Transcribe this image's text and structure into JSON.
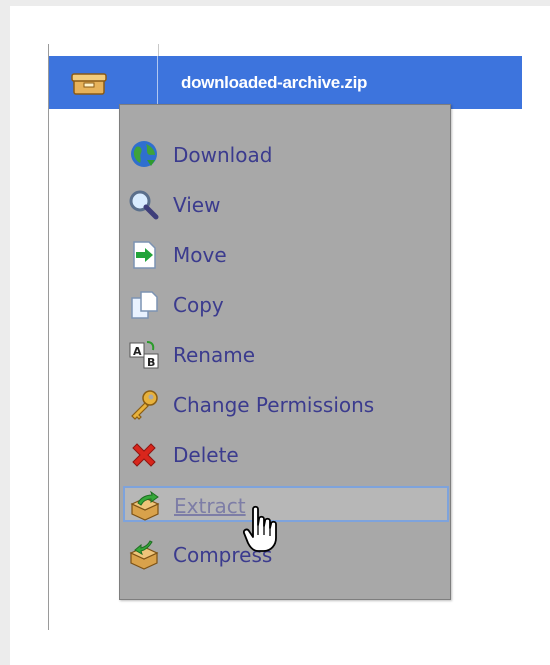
{
  "file_row": {
    "filename": "downloaded-archive.zip",
    "icon": "archive-box-icon"
  },
  "context_menu": {
    "items": [
      {
        "label": "Download",
        "icon": "globe-download-icon"
      },
      {
        "label": "View",
        "icon": "magnifier-icon"
      },
      {
        "label": "Move",
        "icon": "move-arrow-icon"
      },
      {
        "label": "Copy",
        "icon": "copy-pages-icon"
      },
      {
        "label": "Rename",
        "icon": "rename-ab-icon"
      },
      {
        "label": "Change Permissions",
        "icon": "key-icon"
      },
      {
        "label": "Delete",
        "icon": "red-x-icon"
      },
      {
        "label": "Extract",
        "icon": "extract-box-icon",
        "state": "hover"
      },
      {
        "label": "Compress",
        "icon": "compress-box-icon"
      }
    ]
  },
  "colors": {
    "selection": "#3d74dd",
    "menu_background": "#a8a8a8",
    "menu_text": "#3b3b8e",
    "hover_border": "#7ea3dc"
  },
  "cursor": "hand-pointer-icon"
}
